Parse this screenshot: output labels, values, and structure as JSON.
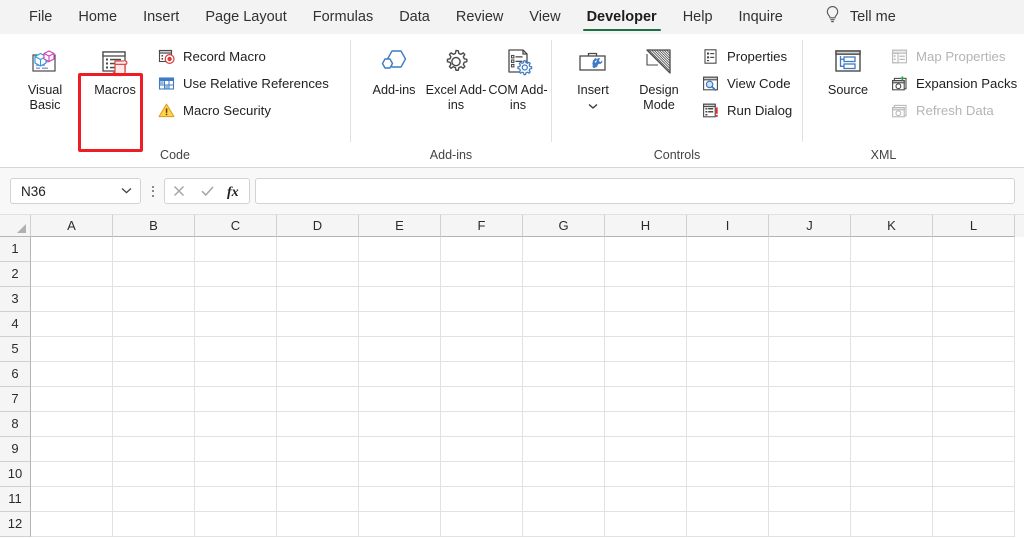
{
  "tabs": [
    {
      "label": "File",
      "active": false
    },
    {
      "label": "Home",
      "active": false
    },
    {
      "label": "Insert",
      "active": false
    },
    {
      "label": "Page Layout",
      "active": false
    },
    {
      "label": "Formulas",
      "active": false
    },
    {
      "label": "Data",
      "active": false
    },
    {
      "label": "Review",
      "active": false
    },
    {
      "label": "View",
      "active": false
    },
    {
      "label": "Developer",
      "active": true
    },
    {
      "label": "Help",
      "active": false
    },
    {
      "label": "Inquire",
      "active": false
    }
  ],
  "tell_me": {
    "label": "Tell me",
    "icon": "lightbulb-icon"
  },
  "ribbon": {
    "groups": [
      {
        "name": "Code",
        "label": "Code",
        "large_buttons": [
          {
            "label": "Visual Basic",
            "icon": "visual-basic-icon",
            "enabled": true,
            "highlighted": false
          },
          {
            "label": "Macros",
            "icon": "macros-icon",
            "enabled": true,
            "highlighted": true
          }
        ],
        "small_buttons": [
          {
            "label": "Record Macro",
            "icon": "record-macro-icon",
            "enabled": true
          },
          {
            "label": "Use Relative References",
            "icon": "relative-references-icon",
            "enabled": true
          },
          {
            "label": "Macro Security",
            "icon": "macro-security-icon",
            "enabled": true
          }
        ]
      },
      {
        "name": "Add-ins",
        "label": "Add-ins",
        "large_buttons": [
          {
            "label": "Add-ins",
            "icon": "addins-hexagon-icon",
            "enabled": true,
            "highlighted": false
          },
          {
            "label": "Excel Add-ins",
            "icon": "excel-addins-gear-icon",
            "enabled": true,
            "highlighted": false
          },
          {
            "label": "COM Add-ins",
            "icon": "com-addins-icon",
            "enabled": true,
            "highlighted": false
          }
        ],
        "small_buttons": []
      },
      {
        "name": "Controls",
        "label": "Controls",
        "large_buttons": [
          {
            "label": "Insert",
            "icon": "insert-controls-icon",
            "enabled": true,
            "highlighted": false,
            "has_dropdown": true
          },
          {
            "label": "Design Mode",
            "icon": "design-mode-icon",
            "enabled": true,
            "highlighted": false
          }
        ],
        "small_buttons": [
          {
            "label": "Properties",
            "icon": "properties-icon",
            "enabled": true
          },
          {
            "label": "View Code",
            "icon": "view-code-icon",
            "enabled": true
          },
          {
            "label": "Run Dialog",
            "icon": "run-dialog-icon",
            "enabled": true
          }
        ]
      },
      {
        "name": "XML",
        "label": "XML",
        "large_buttons": [
          {
            "label": "Source",
            "icon": "xml-source-icon",
            "enabled": true,
            "highlighted": false
          }
        ],
        "small_buttons": [
          {
            "label": "Map Properties",
            "icon": "map-properties-icon",
            "enabled": false
          },
          {
            "label": "Expansion Packs",
            "icon": "expansion-packs-icon",
            "enabled": true
          },
          {
            "label": "Refresh Data",
            "icon": "refresh-data-icon",
            "enabled": false
          }
        ]
      }
    ]
  },
  "formula_bar": {
    "name_box_value": "N36",
    "name_box_placeholder": "Name Box",
    "cancel_label": "Cancel",
    "enter_label": "Enter",
    "fx_label": "Insert Function",
    "formula_value": "",
    "formula_placeholder": ""
  },
  "grid": {
    "columns": [
      "A",
      "B",
      "C",
      "D",
      "E",
      "F",
      "G",
      "H",
      "I",
      "J",
      "K",
      "L"
    ],
    "rows": [
      "1",
      "2",
      "3",
      "4",
      "5",
      "6",
      "7",
      "8",
      "9",
      "10",
      "11",
      "12"
    ],
    "cells": []
  },
  "colors": {
    "accent_green": "#1d7044",
    "highlight_red": "#ee1c25",
    "ribbon_bg": "#ffffff",
    "tabbar_bg": "#f3f3f3",
    "header_bg": "#f5f5f5",
    "gridline": "#e2e2e2"
  }
}
